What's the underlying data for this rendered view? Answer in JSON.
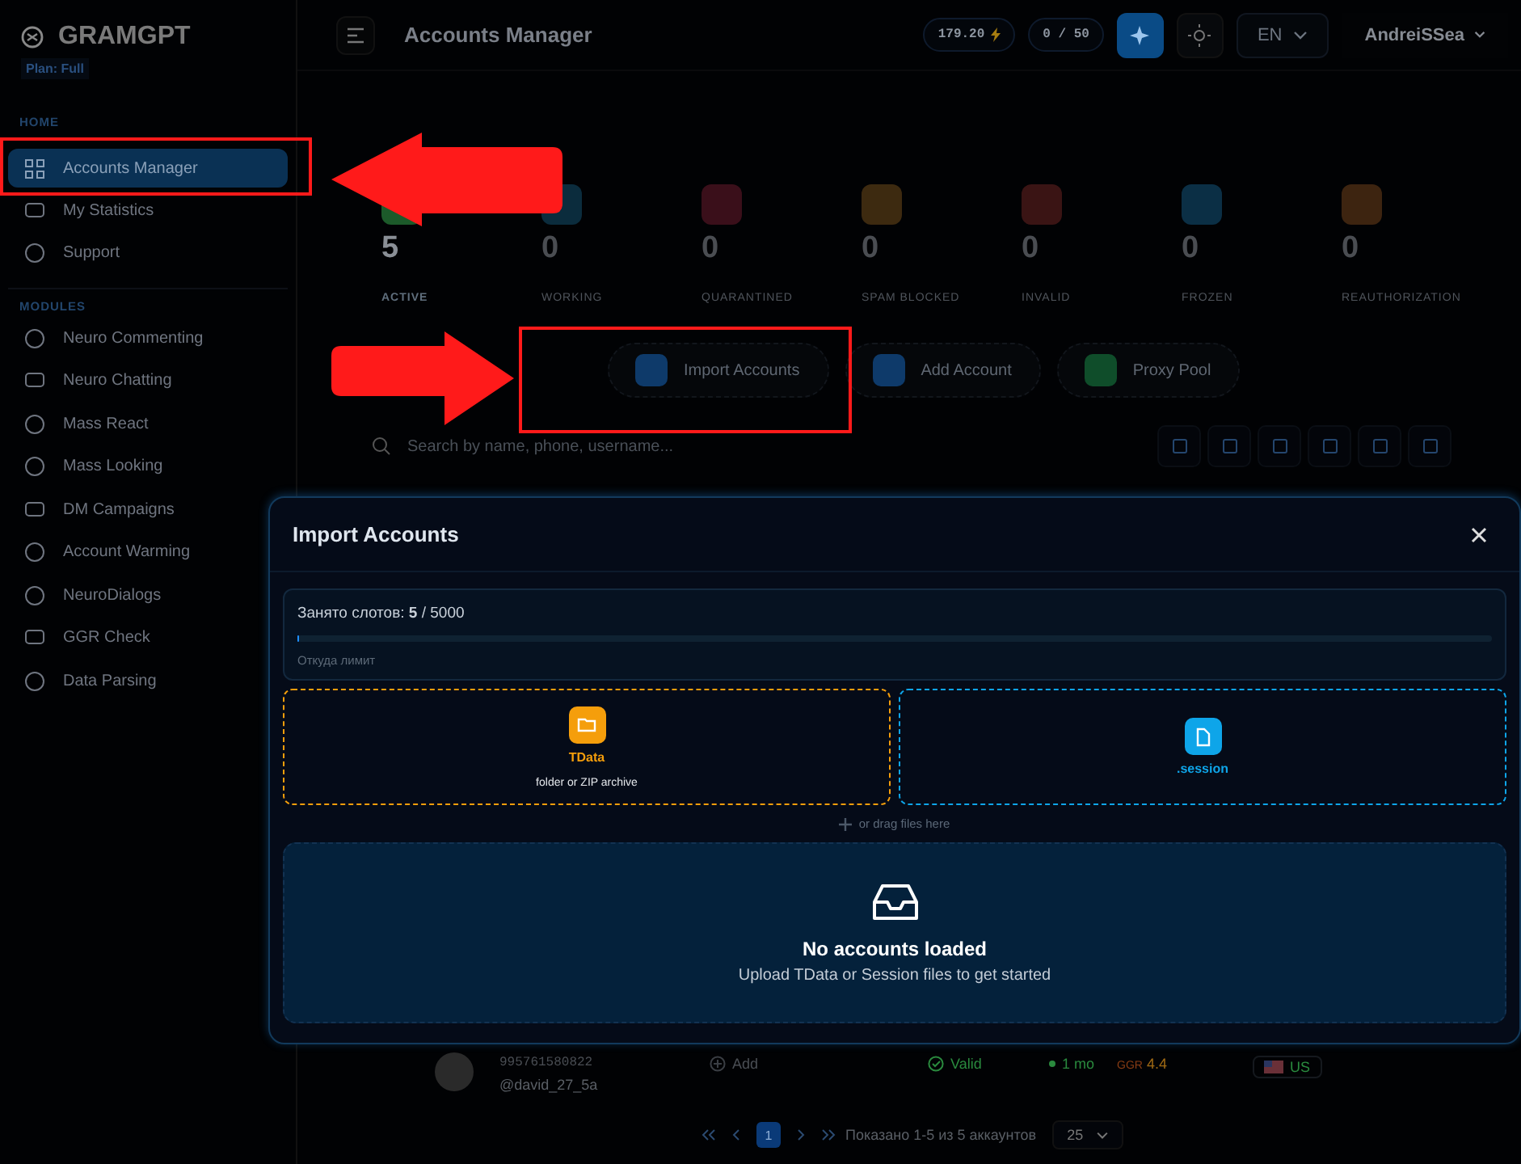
{
  "sidebar": {
    "logo": "GRAMGPT",
    "plan": "Plan: Full",
    "sections": [
      {
        "title": "HOME",
        "items": [
          {
            "label": "Accounts Manager",
            "selected": true
          },
          {
            "label": "My Statistics",
            "selected": false
          },
          {
            "label": "Support",
            "selected": false
          }
        ]
      },
      {
        "title": "MODULES",
        "items": [
          {
            "label": "Neuro Commenting",
            "selected": false
          },
          {
            "label": "Neuro Chatting",
            "selected": false
          },
          {
            "label": "Mass React",
            "selected": false
          },
          {
            "label": "Mass Looking",
            "selected": false
          },
          {
            "label": "DM Campaigns",
            "selected": false
          },
          {
            "label": "Account Warming",
            "selected": false
          },
          {
            "label": "NeuroDialogs",
            "selected": false
          },
          {
            "label": "GGR Check",
            "selected": false
          },
          {
            "label": "Data Parsing",
            "selected": false
          }
        ]
      }
    ]
  },
  "header": {
    "title": "Accounts Manager",
    "credits": "179.20",
    "slots": "0 / 50",
    "language": "EN",
    "user": "AndreiSSea"
  },
  "stats": [
    {
      "value": "5",
      "label": "ACTIVE",
      "color": "#1c5a2a"
    },
    {
      "value": "0",
      "label": "WORKING",
      "color": "#0b2c3d"
    },
    {
      "value": "0",
      "label": "QUARANTINED",
      "color": "#3a0f1a"
    },
    {
      "value": "0",
      "label": "SPAM BLOCKED",
      "color": "#3d2a10"
    },
    {
      "value": "0",
      "label": "INVALID",
      "color": "#3a1414"
    },
    {
      "value": "0",
      "label": "FROZEN",
      "color": "#0b2f45"
    },
    {
      "value": "0",
      "label": "REAUTHORIZATION",
      "color": "#3d2410"
    }
  ],
  "actions": [
    {
      "label": "Import Accounts",
      "color": "#0e3a6a"
    },
    {
      "label": "Add Account",
      "color": "#0e3a6a"
    },
    {
      "label": "Proxy Pool",
      "color": "#0f4d2a"
    }
  ],
  "search": {
    "placeholder": "Search by name, phone, username..."
  },
  "table_row": {
    "phone": "995761580822",
    "username": "@david_27_5a",
    "add": "Add",
    "status": "Valid",
    "age": "1 mo",
    "ggr_label": "GGR",
    "ggr": "4.4",
    "country": "US"
  },
  "pagination": {
    "pages": [
      {
        "label": "1",
        "selected": true
      }
    ],
    "summary": "Показано 1-5 из 5 аккаунтов",
    "per_page": "25"
  },
  "modal": {
    "title": "Import Accounts",
    "slots": {
      "label": "Занято слотов: **5** / 5000",
      "level": 0.001,
      "hint": "Откуда лимит"
    },
    "dropzones": [
      {
        "kind": "tdata",
        "title": "TData",
        "subtitle": "folder or ZIP archive",
        "color": "#f59e0b"
      },
      {
        "kind": "session",
        "title": ".session",
        "color": "#0ea5e9"
      }
    ],
    "drag_hint": "or drag files here",
    "empty": {
      "title": "No accounts loaded",
      "text": "Upload TData or Session files to get started"
    }
  }
}
